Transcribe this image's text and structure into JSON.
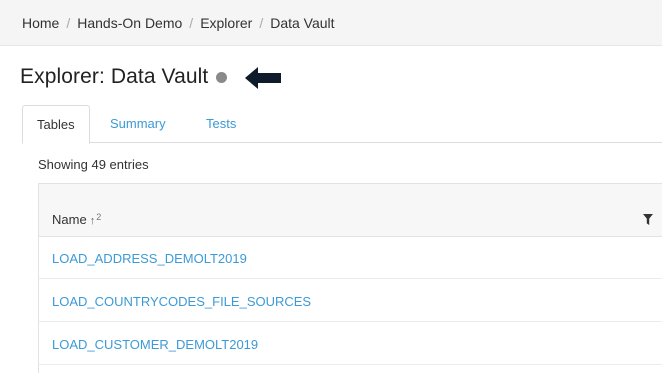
{
  "breadcrumb": {
    "items": [
      "Home",
      "Hands-On Demo",
      "Explorer",
      "Data Vault"
    ],
    "separator": "/"
  },
  "header": {
    "title": "Explorer: Data Vault",
    "status_color": "#8a8a8a"
  },
  "tabs": [
    {
      "label": "Tables",
      "active": true
    },
    {
      "label": "Summary",
      "active": false
    },
    {
      "label": "Tests",
      "active": false
    }
  ],
  "table": {
    "entries_text": "Showing 49 entries",
    "column": {
      "label": "Name",
      "sort_icon": "arrow-up-icon",
      "sort_rank": "2"
    },
    "filter_icon": "filter-icon",
    "rows": [
      "LOAD_ADDRESS_DEMOLT2019",
      "LOAD_COUNTRYCODES_FILE_SOURCES",
      "LOAD_CUSTOMER_DEMOLT2019"
    ]
  },
  "colors": {
    "link": "#3c9ad6",
    "arrow": "#0d1b2a"
  }
}
